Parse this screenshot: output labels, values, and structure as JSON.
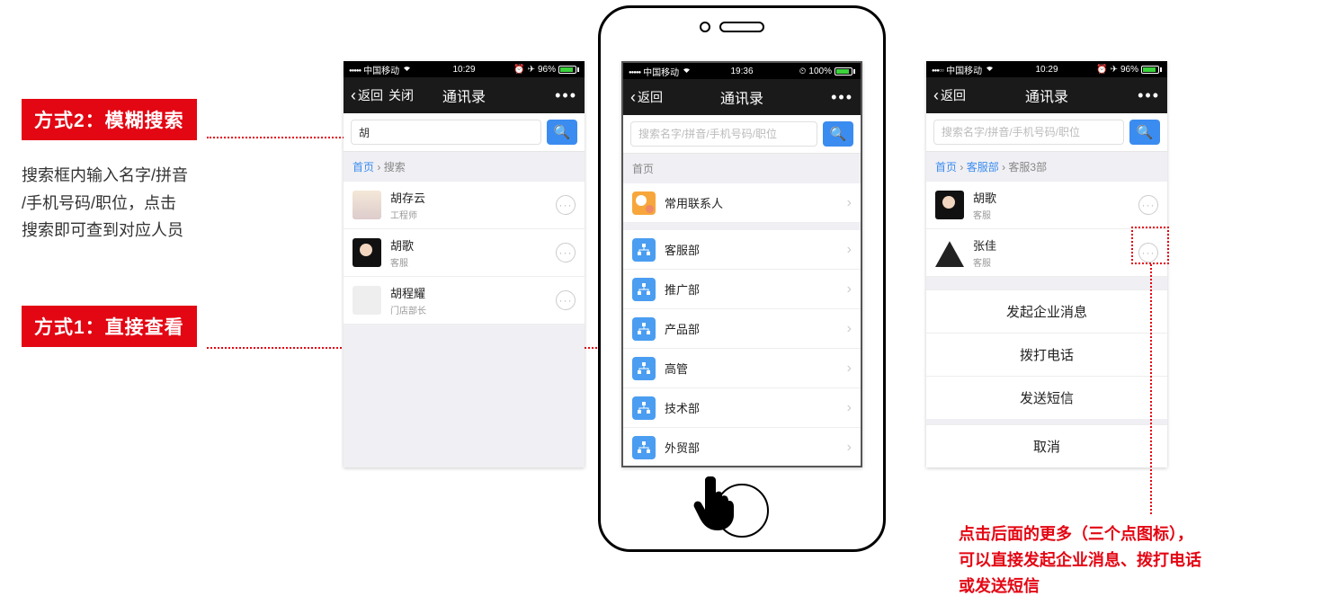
{
  "annotations": {
    "method2_label": "方式2：模糊搜索",
    "method2_desc": "搜索框内输入名字/拼音\n/手机号码/职位，点击\n搜索即可查到对应人员",
    "method1_label": "方式1：直接查看",
    "more_desc": "点击后面的更多（三个点图标），\n可以直接发起企业消息、拨打电话\n或发送短信"
  },
  "statusbar": {
    "carrier": "中国移动",
    "time_a": "10:29",
    "time_b": "19:36",
    "battery_a": "96%",
    "battery_b": "100%"
  },
  "nav": {
    "back": "返回",
    "close": "关闭",
    "title": "通讯录",
    "more": "•••"
  },
  "search": {
    "placeholder": "搜索名字/拼音/手机号码/职位",
    "value_query": "胡"
  },
  "crumbs": {
    "home": "首页",
    "search": "搜索",
    "dept1": "客服部",
    "dept2": "客服3部"
  },
  "screenA_results": [
    {
      "name": "胡存云",
      "sub": "工程师"
    },
    {
      "name": "胡歌",
      "sub": "客服"
    },
    {
      "name": "胡程耀",
      "sub": "门店部长"
    }
  ],
  "screenB": {
    "fav": "常用联系人",
    "depts": [
      "客服部",
      "推广部",
      "产品部",
      "高管",
      "技术部",
      "外贸部"
    ]
  },
  "screenC": {
    "people": [
      {
        "name": "胡歌",
        "sub": "客服"
      },
      {
        "name": "张佳",
        "sub": "客服"
      }
    ],
    "sheet": [
      "发起企业消息",
      "拨打电话",
      "发送短信"
    ],
    "cancel": "取消"
  }
}
